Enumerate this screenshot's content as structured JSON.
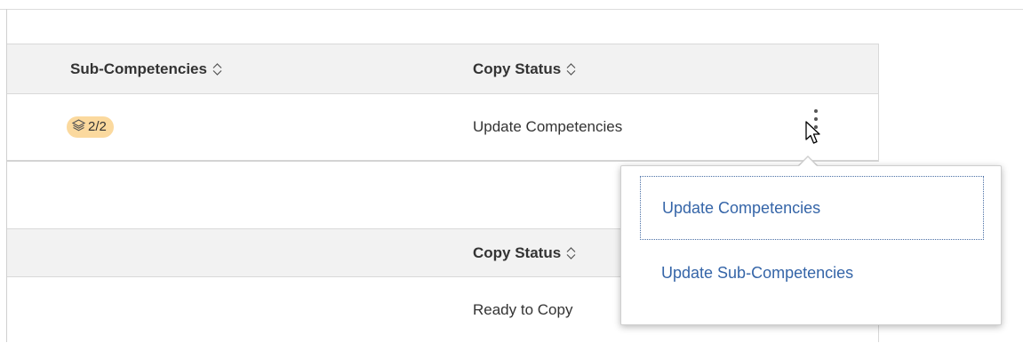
{
  "grid_top": {
    "columns": [
      {
        "label": "Sub-Competencies",
        "icon": "sort-icon"
      },
      {
        "label": "Copy Status",
        "icon": "sort-icon"
      }
    ],
    "row": {
      "sub_competencies_badge": {
        "icon": "layers-icon",
        "value": "2/2"
      },
      "copy_status": "Update Competencies"
    }
  },
  "grid_bottom": {
    "columns": [
      {
        "label": "Copy Status",
        "icon": "sort-icon"
      }
    ],
    "row": {
      "copy_status": "Ready to Copy"
    }
  },
  "actions_menu": {
    "trigger_icon": "kebab-menu-icon",
    "items": [
      {
        "label": "Update Competencies",
        "focused": true
      },
      {
        "label": "Update Sub-Competencies",
        "focused": false
      }
    ]
  },
  "colors": {
    "link": "#3565a8",
    "badge_bg": "#fbd99e",
    "header_bg": "#f2f2f2"
  }
}
